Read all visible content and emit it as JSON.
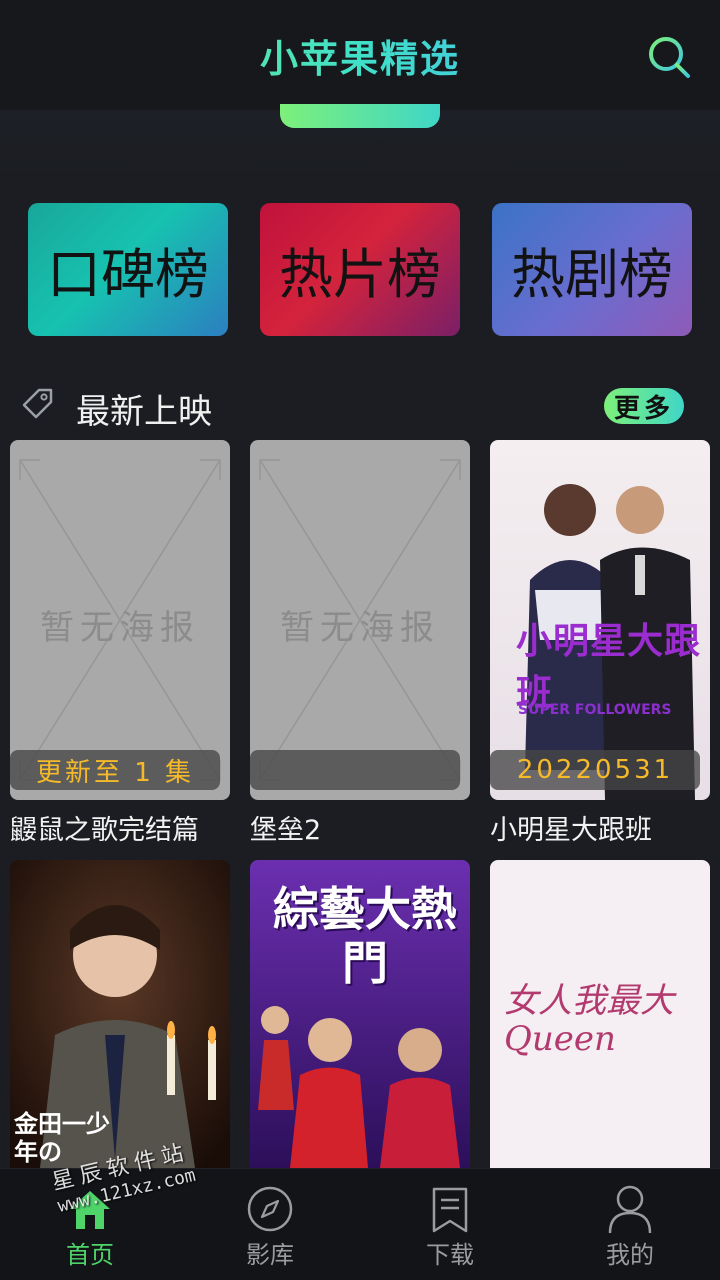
{
  "header": {
    "title": "小苹果精选",
    "search_icon": "search-icon",
    "accent": "#40e0c8"
  },
  "rank_cards": [
    {
      "label": "口碑榜"
    },
    {
      "label": "热片榜"
    },
    {
      "label": "热剧榜"
    }
  ],
  "section": {
    "title": "最新上映",
    "more_label": "更多",
    "icon": "tag-icon"
  },
  "posters": [
    {
      "title": "鼹鼠之歌完结篇",
      "placeholder": "暂无海报",
      "badge": "更新至 1 集"
    },
    {
      "title": "堡垒2",
      "placeholder": "暂无海报",
      "badge": ""
    },
    {
      "title": "小明星大跟班",
      "badge": "20220531",
      "art_text": "小明星大跟班",
      "art_sub": "SUPER FOLLOWERS"
    },
    {
      "art_text": "金田一少年の"
    },
    {
      "art_text": "綜藝大熱門"
    },
    {
      "art_text": "女人我最大 Queen"
    }
  ],
  "nav": [
    {
      "label": "首页",
      "icon": "home-icon",
      "active": true
    },
    {
      "label": "影库",
      "icon": "compass-icon"
    },
    {
      "label": "下载",
      "icon": "bookmark-icon"
    },
    {
      "label": "我的",
      "icon": "user-icon"
    }
  ],
  "watermark": {
    "line1": "星辰软件站",
    "line2": "www.121xz.com"
  }
}
